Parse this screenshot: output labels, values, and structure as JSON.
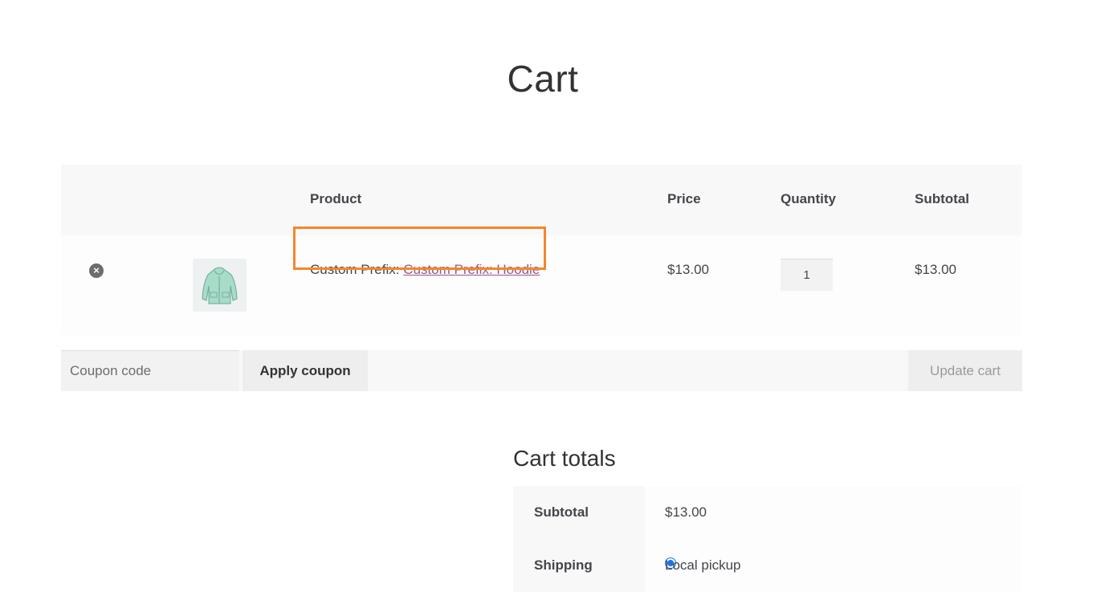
{
  "page": {
    "title": "Cart"
  },
  "table": {
    "headers": {
      "product": "Product",
      "price": "Price",
      "quantity": "Quantity",
      "subtotal": "Subtotal"
    },
    "row": {
      "name_prefix": "Custom Prefix: ",
      "name_link": "Custom Prefix: Hoodie",
      "price": "$13.00",
      "quantity": "1",
      "subtotal": "$13.00"
    }
  },
  "actions": {
    "coupon_placeholder": "Coupon code",
    "apply_label": "Apply coupon",
    "update_label": "Update cart"
  },
  "totals": {
    "title": "Cart totals",
    "subtotal_label": "Subtotal",
    "subtotal_value": "$13.00",
    "shipping_label": "Shipping",
    "shipping_option": "Local pickup"
  },
  "colors": {
    "accent_link": "#96588a",
    "highlight": "#f5862a",
    "radio": "#1a73e8"
  },
  "icons": {
    "remove": "remove-circle-icon",
    "thumbnail": "hoodie-thumbnail"
  }
}
